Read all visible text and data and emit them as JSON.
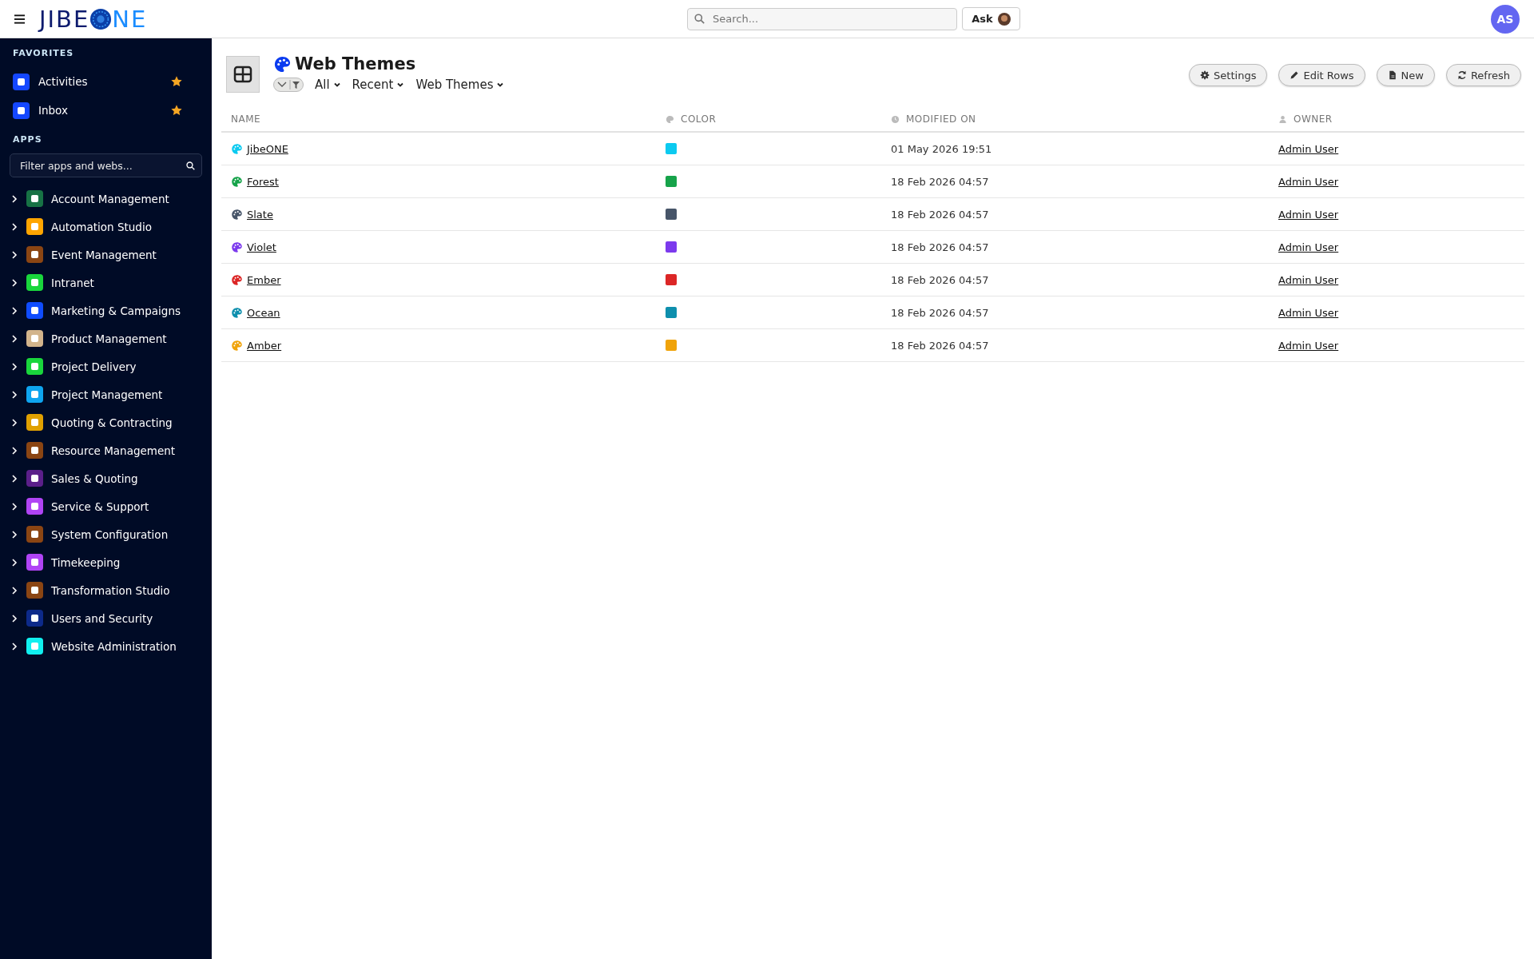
{
  "header": {
    "logo": {
      "before": "JIBE",
      "after": "NE"
    },
    "search": {
      "placeholder": "Search..."
    },
    "ask_button": "Ask",
    "user_avatar": "AS"
  },
  "sidebar": {
    "favorites_heading": "FAVORITES",
    "favorites": [
      {
        "label": "Activities",
        "color": "#1447ff",
        "starred": true
      },
      {
        "label": "Inbox",
        "color": "#1447ff",
        "starred": true
      }
    ],
    "apps_heading": "APPS",
    "filter": {
      "placeholder": "Filter apps and webs..."
    },
    "apps": [
      {
        "label": "Account Management",
        "color": "#177245",
        "expanded": false
      },
      {
        "label": "Automation Studio",
        "color": "#ffa500",
        "expanded": false
      },
      {
        "label": "Event Management",
        "color": "#8b4513",
        "expanded": false
      },
      {
        "label": "Intranet",
        "color": "#19d63c",
        "expanded": false
      },
      {
        "label": "Marketing & Campaigns",
        "color": "#0f4cff",
        "expanded": false
      },
      {
        "label": "Product Management",
        "color": "#d2b48c",
        "expanded": false
      },
      {
        "label": "Project Delivery",
        "color": "#19d63c",
        "expanded": false
      },
      {
        "label": "Project Management",
        "color": "#0ea5f0",
        "expanded": false
      },
      {
        "label": "Quoting & Contracting",
        "color": "#e0a000",
        "expanded": false
      },
      {
        "label": "Resource Management",
        "color": "#8b4513",
        "expanded": false
      },
      {
        "label": "Sales & Quoting",
        "color": "#5b1f8a",
        "expanded": false
      },
      {
        "label": "Service & Support",
        "color": "#b044f5",
        "expanded": false
      },
      {
        "label": "System Configuration",
        "color": "#8b4513",
        "expanded": false
      },
      {
        "label": "Timekeeping",
        "color": "#b044f5",
        "expanded": false
      },
      {
        "label": "Transformation Studio",
        "color": "#8b4513",
        "expanded": false
      },
      {
        "label": "Users and Security",
        "color": "#0d2a8a",
        "expanded": false
      },
      {
        "label": "Website Administration",
        "color": "#10f0f0",
        "expanded": false
      }
    ]
  },
  "page": {
    "title": "Web Themes",
    "filters": [
      "All",
      "Recent",
      "Web Themes"
    ],
    "buttons": [
      {
        "label": "Settings",
        "kind": "gear"
      },
      {
        "label": "Edit Rows",
        "kind": "pencil"
      },
      {
        "label": "New",
        "kind": "file"
      },
      {
        "label": "Refresh",
        "kind": "refresh"
      }
    ],
    "table": {
      "columns": [
        {
          "label": "NAME",
          "kind": "plain"
        },
        {
          "label": "COLOR",
          "kind": "palette"
        },
        {
          "label": "MODIFIED ON",
          "kind": "clock"
        },
        {
          "label": "OWNER",
          "kind": "user"
        }
      ],
      "rows": [
        {
          "name": "JibeONE",
          "color": "#0ccaf0",
          "modified_on": "01 May 2026 19:51",
          "owner": "Admin User"
        },
        {
          "name": "Forest",
          "color": "#16a34a",
          "modified_on": "18 Feb 2026 04:57",
          "owner": "Admin User"
        },
        {
          "name": "Slate",
          "color": "#475569",
          "modified_on": "18 Feb 2026 04:57",
          "owner": "Admin User"
        },
        {
          "name": "Violet",
          "color": "#7c3aed",
          "modified_on": "18 Feb 2026 04:57",
          "owner": "Admin User"
        },
        {
          "name": "Ember",
          "color": "#dc2626",
          "modified_on": "18 Feb 2026 04:57",
          "owner": "Admin User"
        },
        {
          "name": "Ocean",
          "color": "#0e8fad",
          "modified_on": "18 Feb 2026 04:57",
          "owner": "Admin User"
        },
        {
          "name": "Amber",
          "color": "#f0a30a",
          "modified_on": "18 Feb 2026 04:57",
          "owner": "Admin User"
        }
      ]
    }
  }
}
